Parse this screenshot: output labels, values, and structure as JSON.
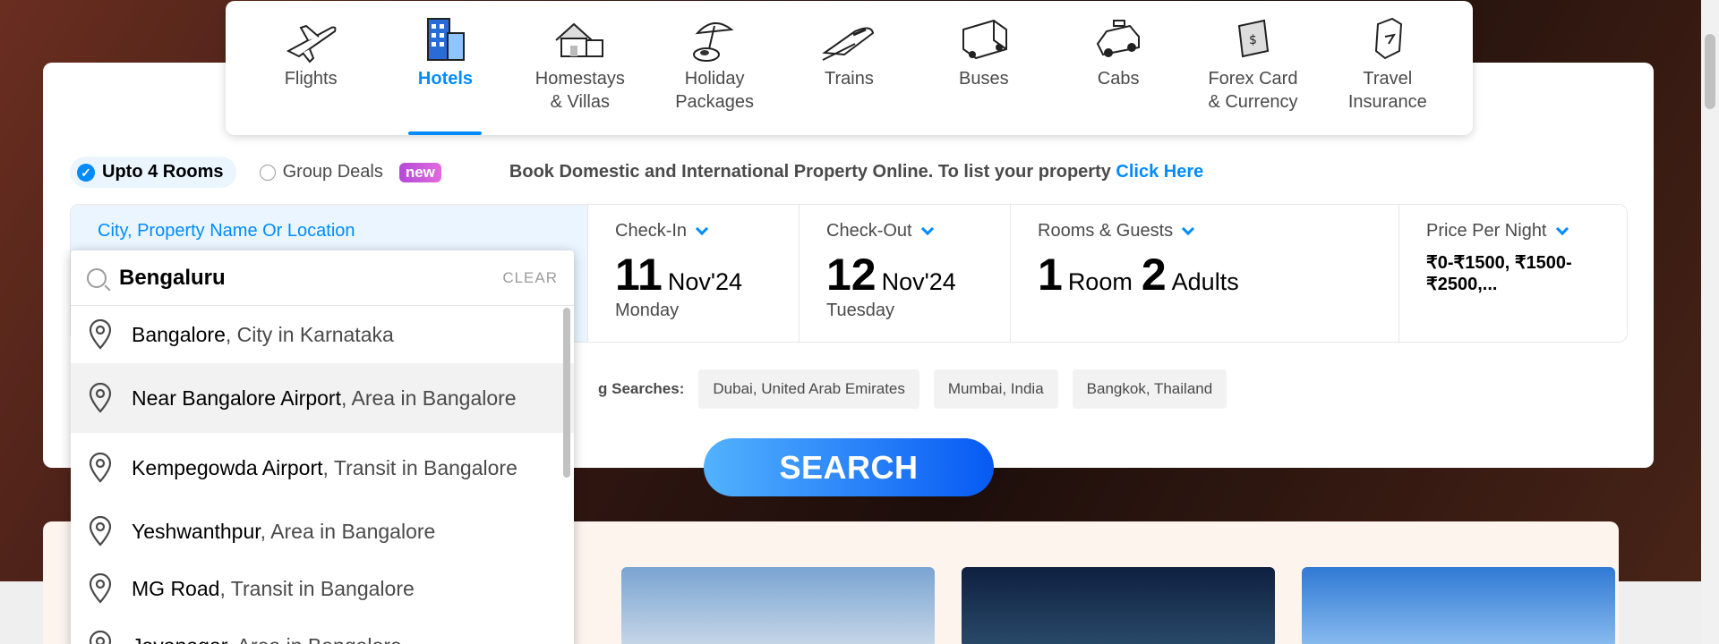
{
  "nav": [
    {
      "label": "Flights",
      "icon": "flight-icon",
      "active": false
    },
    {
      "label": "Hotels",
      "icon": "hotel-icon",
      "active": true
    },
    {
      "label": "Homestays\n& Villas",
      "icon": "homestay-icon",
      "active": false
    },
    {
      "label": "Holiday\nPackages",
      "icon": "holiday-icon",
      "active": false
    },
    {
      "label": "Trains",
      "icon": "train-icon",
      "active": false
    },
    {
      "label": "Buses",
      "icon": "bus-icon",
      "active": false
    },
    {
      "label": "Cabs",
      "icon": "cab-icon",
      "active": false
    },
    {
      "label": "Forex Card\n& Currency",
      "icon": "forex-icon",
      "active": false
    },
    {
      "label": "Travel\nInsurance",
      "icon": "insurance-icon",
      "active": false
    }
  ],
  "options": {
    "rooms_label": "Upto 4 Rooms",
    "group_label": "Group Deals",
    "new_badge": "new",
    "promo_text": "Book Domestic and International Property Online. To list your property ",
    "promo_link": "Click Here"
  },
  "fields": {
    "city_label": "City, Property Name Or Location",
    "checkin_label": "Check-In",
    "checkin_day": "11",
    "checkin_month": "Nov'24",
    "checkin_weekday": "Monday",
    "checkout_label": "Check-Out",
    "checkout_day": "12",
    "checkout_month": "Nov'24",
    "checkout_weekday": "Tuesday",
    "guests_label": "Rooms & Guests",
    "rooms_count": "1",
    "rooms_unit": "Room",
    "adults_count": "2",
    "adults_unit": "Adults",
    "price_label": "Price Per Night",
    "price_value": "₹0-₹1500, ₹1500-₹2500,..."
  },
  "trending": {
    "label": "g Searches:",
    "chips": [
      "Dubai, United Arab Emirates",
      "Mumbai, India",
      "Bangkok, Thailand"
    ]
  },
  "search_button": "SEARCH",
  "autocomplete": {
    "query": "Bengaluru",
    "clear_label": "CLEAR",
    "results": [
      {
        "name": "Bangalore",
        "detail": ", City in Karnataka",
        "highlighted": false
      },
      {
        "name": "Near Bangalore Airport",
        "detail": ", Area in Bangalore",
        "highlighted": true
      },
      {
        "name": "Kempegowda Airport",
        "detail": ", Transit in Bangalore",
        "highlighted": false
      },
      {
        "name": "Yeshwanthpur",
        "detail": ", Area in Bangalore",
        "highlighted": false
      },
      {
        "name": "MG Road",
        "detail": ", Transit in Bangalore",
        "highlighted": false
      },
      {
        "name": "Jayanagar",
        "detail": ", Area in Bangalore",
        "highlighted": false
      }
    ]
  },
  "colors": {
    "accent": "#008cff",
    "selected_bg": "#eaf5ff",
    "badge": "#c45be0"
  }
}
